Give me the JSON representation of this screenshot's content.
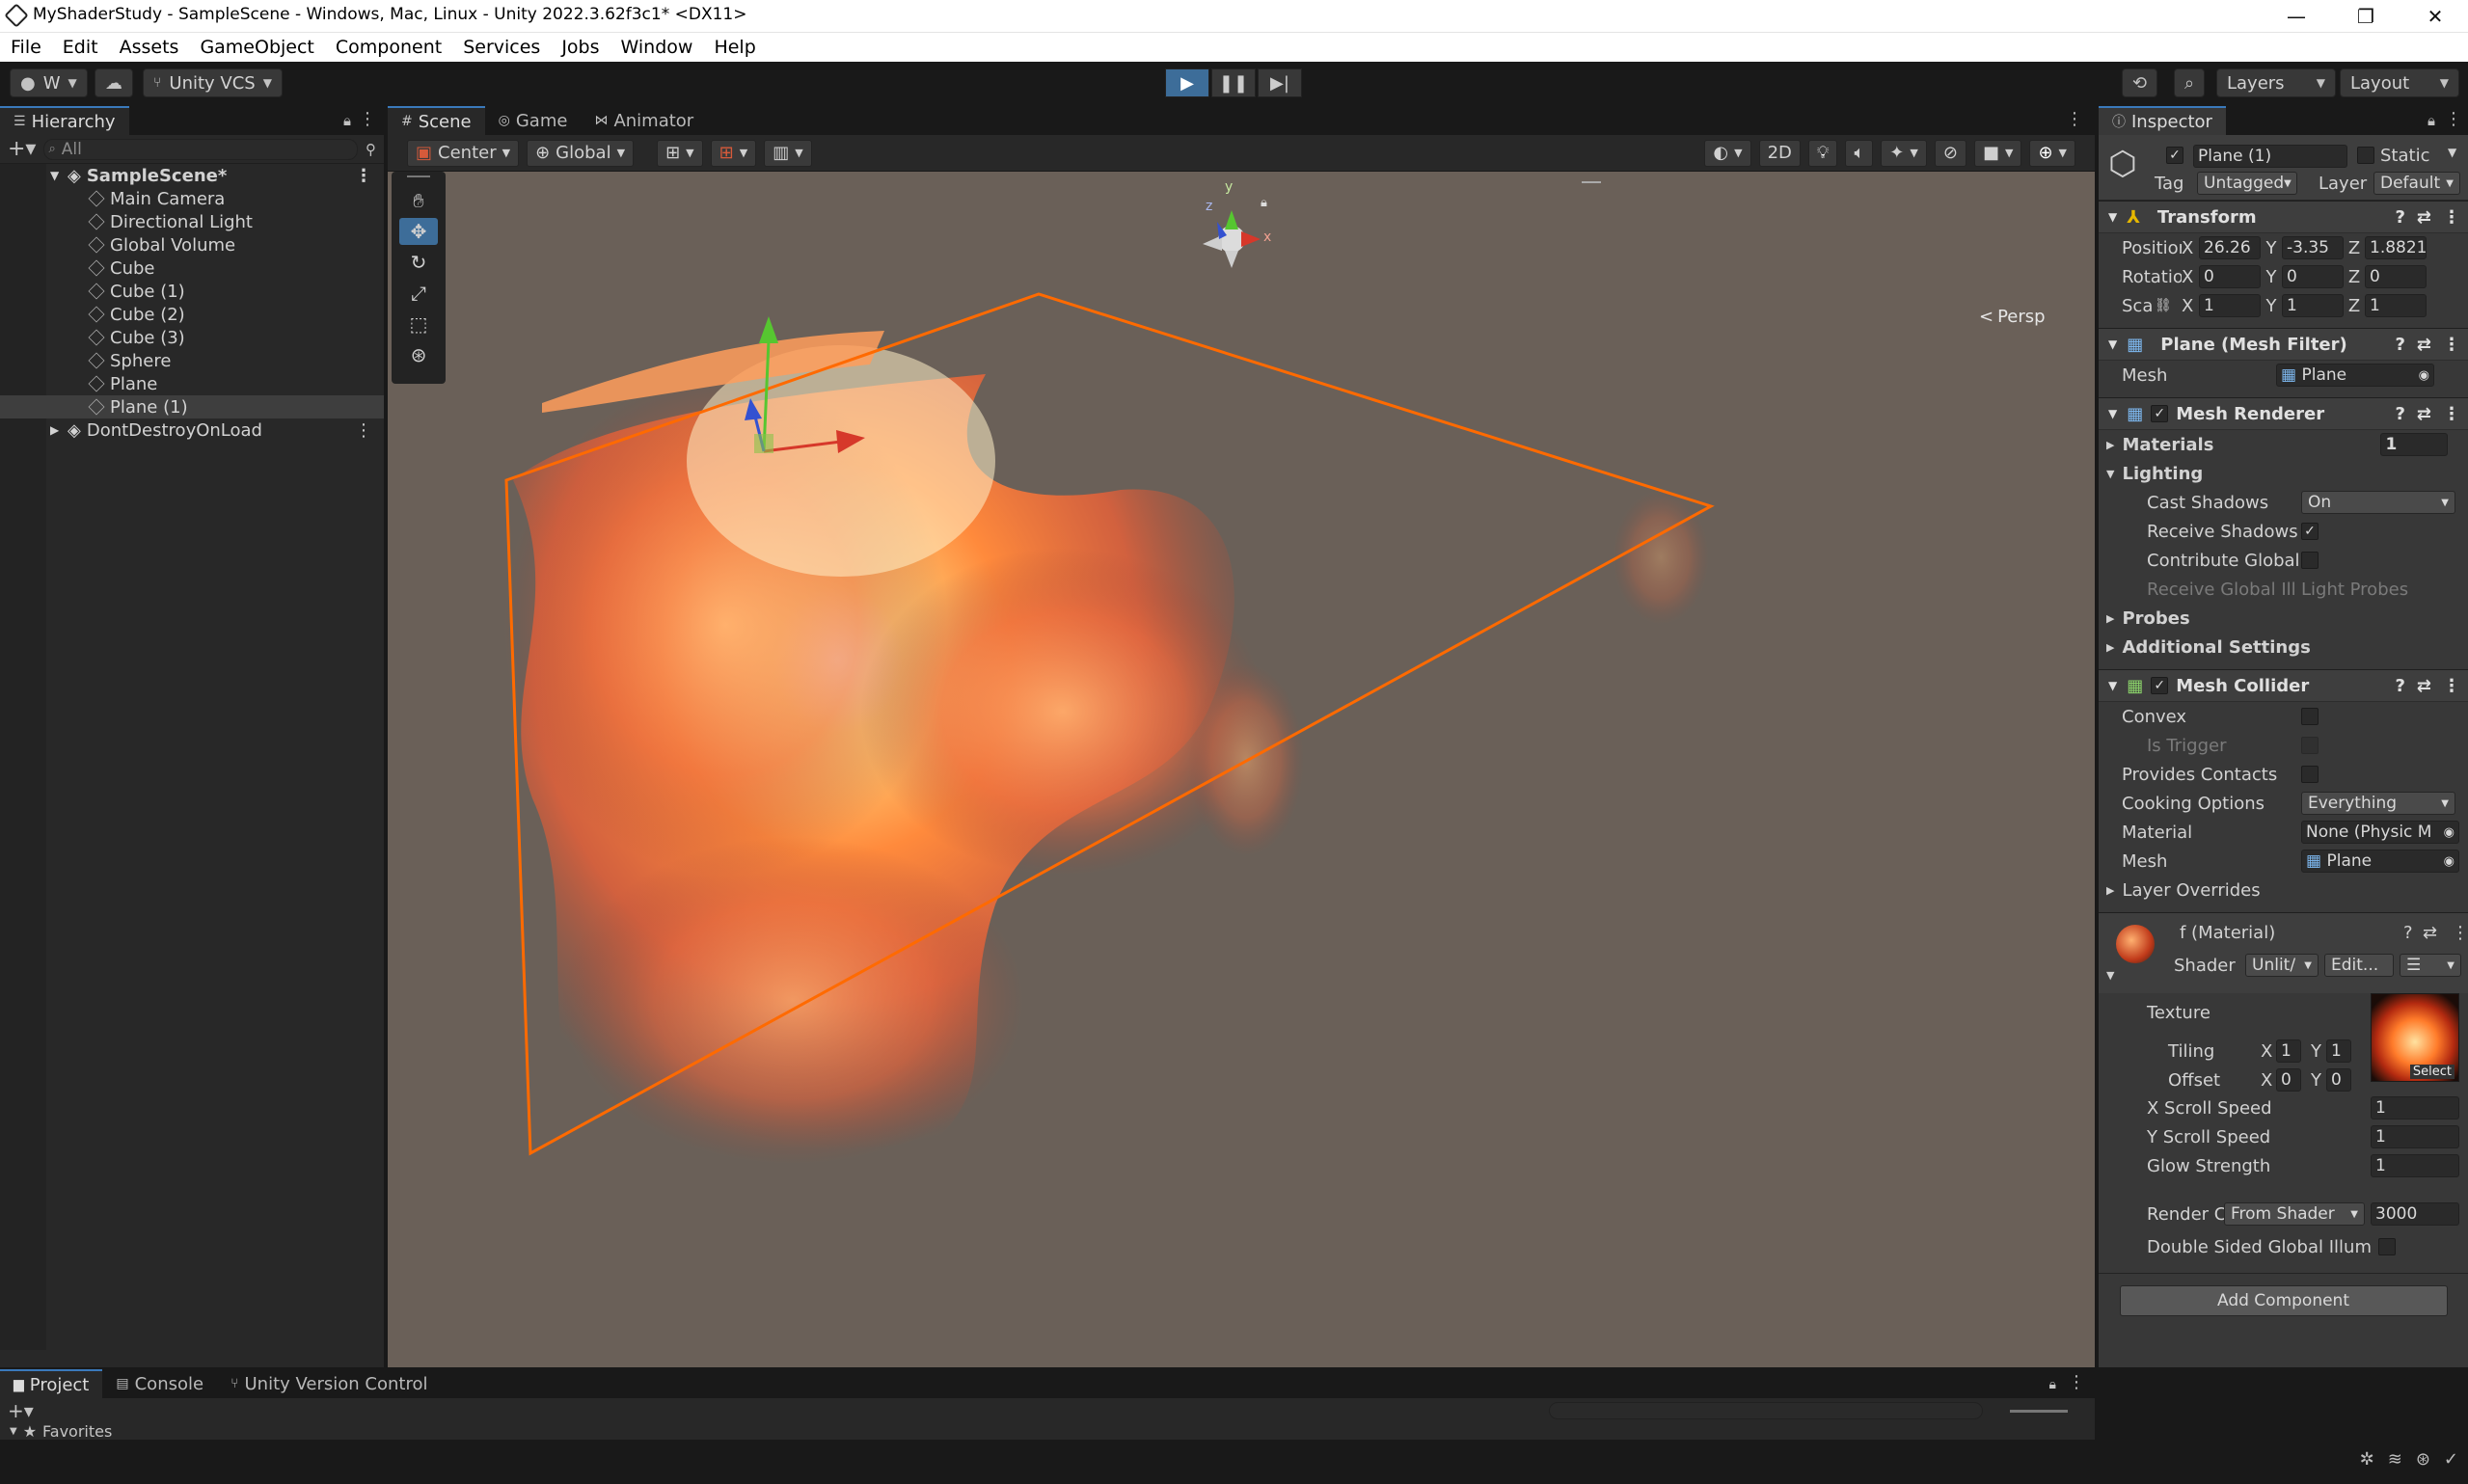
{
  "window": {
    "title": "MyShaderStudy - SampleScene - Windows, Mac, Linux - Unity 2022.3.62f3c1* <DX11>",
    "minimize": "—",
    "maximize": "❐",
    "close": "✕"
  },
  "menu": [
    "File",
    "Edit",
    "Assets",
    "GameObject",
    "Component",
    "Services",
    "Jobs",
    "Window",
    "Help"
  ],
  "toolbar": {
    "account": "W",
    "vcs": "Unity VCS",
    "layers": "Layers",
    "layout": "Layout"
  },
  "hierarchy": {
    "tab": "Hierarchy",
    "search_placeholder": "All",
    "scene": "SampleScene*",
    "items": [
      "Main Camera",
      "Directional Light",
      "Global Volume",
      "Cube",
      "Cube (1)",
      "Cube (2)",
      "Cube (3)",
      "Sphere",
      "Plane",
      "Plane (1)"
    ],
    "selected_index": 9,
    "dont_destroy": "DontDestroyOnLoad"
  },
  "scene_tabs": [
    "Scene",
    "Game",
    "Animator"
  ],
  "scene_toolbar": {
    "pivot": "Center",
    "space": "Global",
    "mode_2d": "2D"
  },
  "gizmo": {
    "persp": "Persp",
    "axis_y": "y",
    "axis_x": "x",
    "axis_z": "z"
  },
  "inspector": {
    "tab": "Inspector",
    "object_name": "Plane (1)",
    "static_label": "Static",
    "tag_label": "Tag",
    "tag_value": "Untagged",
    "layer_label": "Layer",
    "layer_value": "Default",
    "transform": {
      "title": "Transform",
      "position_label": "Position",
      "rotation_label": "Rotation",
      "scale_label": "Scale",
      "position": {
        "x": "26.26",
        "y": "-3.35",
        "z": "1.8821"
      },
      "rotation": {
        "x": "0",
        "y": "0",
        "z": "0"
      },
      "scale": {
        "x": "1",
        "y": "1",
        "z": "1"
      }
    },
    "mesh_filter": {
      "title": "Plane (Mesh Filter)",
      "mesh_label": "Mesh",
      "mesh_value": "Plane"
    },
    "mesh_renderer": {
      "title": "Mesh Renderer",
      "materials_label": "Materials",
      "materials_count": "1",
      "lighting_label": "Lighting",
      "cast_shadows_label": "Cast Shadows",
      "cast_shadows_value": "On",
      "receive_shadows_label": "Receive Shadows",
      "contribute_gi_label": "Contribute Global",
      "receive_gi_label": "Receive Global Ill",
      "receive_gi_value": "Light Probes",
      "probes_label": "Probes",
      "additional_label": "Additional Settings"
    },
    "mesh_collider": {
      "title": "Mesh Collider",
      "convex_label": "Convex",
      "trigger_label": "Is Trigger",
      "contacts_label": "Provides Contacts",
      "cooking_label": "Cooking Options",
      "cooking_value": "Everything",
      "material_label": "Material",
      "material_value": "None (Physic M",
      "mesh_label": "Mesh",
      "mesh_value": "Plane",
      "overrides_label": "Layer Overrides"
    },
    "material": {
      "title": "f (Material)",
      "shader_label": "Shader",
      "shader_value": "Unlit/",
      "edit_label": "Edit...",
      "texture_label": "Texture",
      "tiling_label": "Tiling",
      "offset_label": "Offset",
      "tiling": {
        "x": "1",
        "y": "1"
      },
      "offset": {
        "x": "0",
        "y": "0"
      },
      "select_label": "Select",
      "xscroll_label": "X Scroll Speed",
      "xscroll_value": "1",
      "yscroll_label": "Y Scroll Speed",
      "yscroll_value": "1",
      "glow_label": "Glow Strength",
      "glow_value": "1",
      "render_queue_label": "Render C",
      "render_queue_mode": "From Shader",
      "render_queue_value": "3000",
      "double_sided_label": "Double Sided Global Illum"
    },
    "add_component": "Add Component"
  },
  "bottom_tabs": [
    "Project",
    "Console",
    "Unity Version Control"
  ],
  "favorites": "Favorites",
  "colors": {
    "accent": "#3a79bb",
    "play_active": "#3d6d99",
    "selection_outline": "#ff6a00",
    "viewport_bg": "#6a6058"
  }
}
